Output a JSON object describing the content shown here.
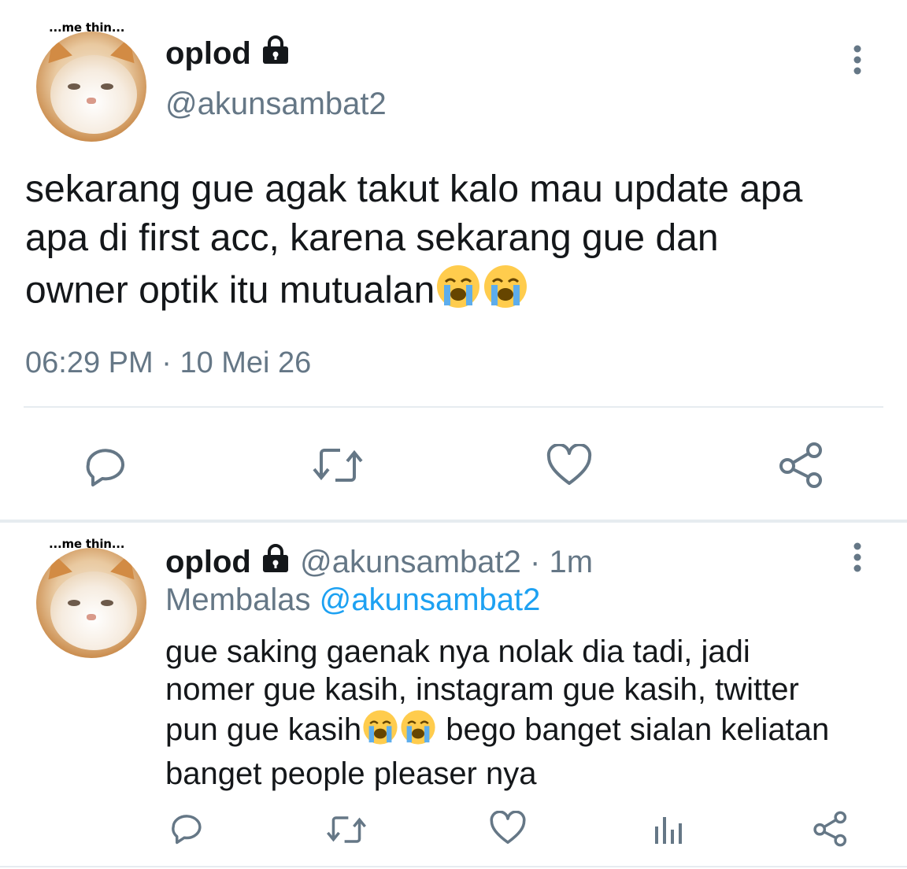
{
  "main_tweet": {
    "avatar_caption": "...me thin...",
    "display_name": "oplod",
    "handle": "@akunsambat2",
    "text_line1": "sekarang gue agak takut kalo mau update apa",
    "text_line2": "apa di first acc, karena sekarang gue dan",
    "text_line3": "owner optik itu mutualan",
    "time": "06:29 PM",
    "separator": "·",
    "date": "10 Mei 26",
    "actions": [
      "reply-icon",
      "retweet-icon",
      "like-icon",
      "share-icon"
    ]
  },
  "reply_tweet": {
    "avatar_caption": "...me thin...",
    "display_name": "oplod",
    "handle": "@akunsambat2",
    "dot": "·",
    "age": "1m",
    "replying_prefix": "Membalas",
    "replying_to": "@akunsambat2",
    "text_line1": "gue saking gaenak nya nolak dia tadi, jadi",
    "text_line2": "nomer gue kasih, instagram gue kasih, twitter",
    "text_line3a": "pun gue kasih",
    "text_line3b": " bego banget sialan keliatan",
    "text_line4": "banget people pleaser nya",
    "actions": [
      "reply-icon",
      "retweet-icon",
      "like-icon",
      "analytics-icon",
      "share-icon"
    ]
  },
  "colors": {
    "text": "#14171a",
    "secondary": "#657786",
    "link": "#1da1f2",
    "divider": "#e6ecf0"
  }
}
